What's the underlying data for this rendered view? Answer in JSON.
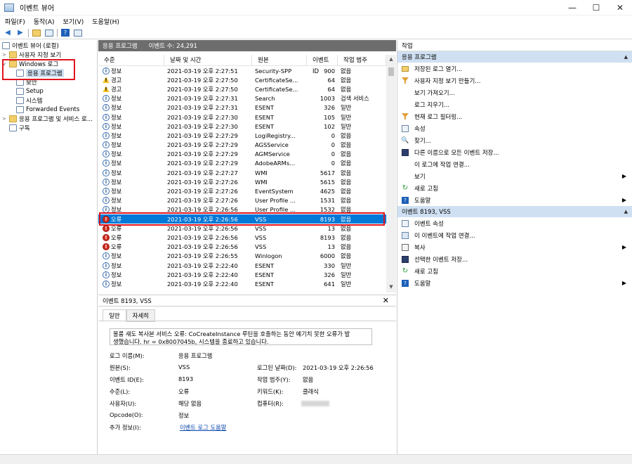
{
  "window": {
    "title": "이벤트 뷰어",
    "min": "—",
    "max": "☐",
    "close": "✕"
  },
  "menu": [
    "파일(F)",
    "동작(A)",
    "보기(V)",
    "도움말(H)"
  ],
  "tree": {
    "root": "이벤트 뷰어 (로컬)",
    "custom_views": "사용자 지정 보기",
    "windows_logs": "Windows 로그",
    "app": "응용 프로그램",
    "security": "보안",
    "setup": "Setup",
    "system": "시스템",
    "forwarded": "Forwarded Events",
    "apps_services": "응용 프로그램 및 서비스 로...",
    "subscriptions": "구독"
  },
  "center": {
    "title": "응용 프로그램",
    "count": "이벤트 수: 24,291",
    "columns": [
      "수준",
      "날짜 및 시간",
      "원본",
      "이벤트 ID",
      "작업 범주"
    ],
    "rows": [
      {
        "level": "정보",
        "type": "info",
        "date": "2021-03-19 오후 2:27:51",
        "src": "Security-SPP",
        "id": "900",
        "cat": "없음"
      },
      {
        "level": "경고",
        "type": "warn",
        "date": "2021-03-19 오후 2:27:50",
        "src": "CertificateSe...",
        "id": "64",
        "cat": "없음"
      },
      {
        "level": "경고",
        "type": "warn",
        "date": "2021-03-19 오후 2:27:50",
        "src": "CertificateSe...",
        "id": "64",
        "cat": "없음"
      },
      {
        "level": "정보",
        "type": "info",
        "date": "2021-03-19 오후 2:27:31",
        "src": "Search",
        "id": "1003",
        "cat": "검색 서비스"
      },
      {
        "level": "정보",
        "type": "info",
        "date": "2021-03-19 오후 2:27:31",
        "src": "ESENT",
        "id": "326",
        "cat": "일반"
      },
      {
        "level": "정보",
        "type": "info",
        "date": "2021-03-19 오후 2:27:30",
        "src": "ESENT",
        "id": "105",
        "cat": "일반"
      },
      {
        "level": "정보",
        "type": "info",
        "date": "2021-03-19 오후 2:27:30",
        "src": "ESENT",
        "id": "102",
        "cat": "일반"
      },
      {
        "level": "정보",
        "type": "info",
        "date": "2021-03-19 오후 2:27:29",
        "src": "LogiRegistry...",
        "id": "0",
        "cat": "없음"
      },
      {
        "level": "정보",
        "type": "info",
        "date": "2021-03-19 오후 2:27:29",
        "src": "AGSService",
        "id": "0",
        "cat": "없음"
      },
      {
        "level": "정보",
        "type": "info",
        "date": "2021-03-19 오후 2:27:29",
        "src": "AGMService",
        "id": "0",
        "cat": "없음"
      },
      {
        "level": "정보",
        "type": "info",
        "date": "2021-03-19 오후 2:27:29",
        "src": "AdobeARMs...",
        "id": "0",
        "cat": "없음"
      },
      {
        "level": "정보",
        "type": "info",
        "date": "2021-03-19 오후 2:27:27",
        "src": "WMI",
        "id": "5617",
        "cat": "없음"
      },
      {
        "level": "정보",
        "type": "info",
        "date": "2021-03-19 오후 2:27:26",
        "src": "WMI",
        "id": "5615",
        "cat": "없음"
      },
      {
        "level": "정보",
        "type": "info",
        "date": "2021-03-19 오후 2:27:26",
        "src": "EventSystem",
        "id": "4625",
        "cat": "없음"
      },
      {
        "level": "정보",
        "type": "info",
        "date": "2021-03-19 오후 2:27:26",
        "src": "User Profile ...",
        "id": "1531",
        "cat": "없음"
      },
      {
        "level": "정보",
        "type": "info",
        "date": "2021-03-19 오후 2:26:56",
        "src": "User Profile ...",
        "id": "1532",
        "cat": "없음"
      },
      {
        "level": "오류",
        "type": "err",
        "date": "2021-03-19 오후 2:26:56",
        "src": "VSS",
        "id": "8193",
        "cat": "없음",
        "selected": true
      },
      {
        "level": "오류",
        "type": "err",
        "date": "2021-03-19 오후 2:26:56",
        "src": "VSS",
        "id": "13",
        "cat": "없음"
      },
      {
        "level": "오류",
        "type": "err",
        "date": "2021-03-19 오후 2:26:56",
        "src": "VSS",
        "id": "8193",
        "cat": "없음"
      },
      {
        "level": "오류",
        "type": "err",
        "date": "2021-03-19 오후 2:26:56",
        "src": "VSS",
        "id": "13",
        "cat": "없음"
      },
      {
        "level": "정보",
        "type": "info",
        "date": "2021-03-19 오후 2:26:55",
        "src": "Winlogon",
        "id": "6000",
        "cat": "없음"
      },
      {
        "level": "정보",
        "type": "info",
        "date": "2021-03-19 오후 2:22:40",
        "src": "ESENT",
        "id": "330",
        "cat": "일반"
      },
      {
        "level": "정보",
        "type": "info",
        "date": "2021-03-19 오후 2:22:40",
        "src": "ESENT",
        "id": "326",
        "cat": "일반"
      },
      {
        "level": "정보",
        "type": "info",
        "date": "2021-03-19 오후 2:22:40",
        "src": "ESENT",
        "id": "641",
        "cat": "일반"
      }
    ]
  },
  "detail": {
    "title": "이벤트 8193, VSS",
    "close": "✕",
    "tab_general": "일반",
    "tab_details": "자세히",
    "message_line1": "볼륨 섀도 복사본 서비스 오류: CoCreateInstance 루틴을 호출하는 동안 예기치 못한 오류가 발",
    "message_line2": "생했습니다. hr = 0x8007045b, 시스템을 종료하고 있습니다.",
    "log_name_label": "로그 이름(M):",
    "log_name": "응용 프로그램",
    "source_label": "원본(S):",
    "source": "VSS",
    "logged_label": "로그된 날짜(D):",
    "logged": "2021-03-19 오후 2:26:56",
    "event_id_label": "이벤트 ID(E):",
    "event_id": "8193",
    "task_label": "작업 범주(Y):",
    "task": "없음",
    "level_label": "수준(L):",
    "level": "오류",
    "keywords_label": "키워드(K):",
    "keywords": "클래식",
    "user_label": "사용자(U):",
    "user": "해당 없음",
    "computer_label": "컴퓨터(R):",
    "opcode_label": "Opcode(O):",
    "opcode": "정보",
    "more_label": "추가 정보(I):",
    "more_link": "이벤트 로그 도움말"
  },
  "actions": {
    "header": "작업",
    "sec1": "응용 프로그램",
    "items1": [
      {
        "label": "저장된 로그 열기...",
        "icon": "folder-open-icon"
      },
      {
        "label": "사용자 지정 보기 만들기...",
        "icon": "filter-icon"
      },
      {
        "label": "보기 가져오기...",
        "icon": ""
      },
      {
        "label": "로그 지우기...",
        "icon": ""
      },
      {
        "label": "현재 로그 필터링...",
        "icon": "filter-icon"
      },
      {
        "label": "속성",
        "icon": "properties-icon"
      },
      {
        "label": "찾기...",
        "icon": "find-icon"
      },
      {
        "label": "다른 이름으로 모든 이벤트 저장...",
        "icon": "save-icon"
      },
      {
        "label": "이 로그에 작업 연결...",
        "icon": ""
      },
      {
        "label": "보기",
        "icon": "",
        "chev": true
      },
      {
        "label": "새로 고침",
        "icon": "refresh-icon"
      },
      {
        "label": "도움말",
        "icon": "help-icon",
        "chev": true
      }
    ],
    "sec2": "이벤트 8193, VSS",
    "items2": [
      {
        "label": "이벤트 속성",
        "icon": "properties-icon"
      },
      {
        "label": "이 이벤트에 작업 연결...",
        "icon": "task-icon"
      },
      {
        "label": "복사",
        "icon": "copy-icon",
        "chev": true
      },
      {
        "label": "선택한 이벤트 저장...",
        "icon": "save-icon"
      },
      {
        "label": "새로 고침",
        "icon": "refresh-icon"
      },
      {
        "label": "도움말",
        "icon": "help-icon",
        "chev": true
      }
    ]
  }
}
